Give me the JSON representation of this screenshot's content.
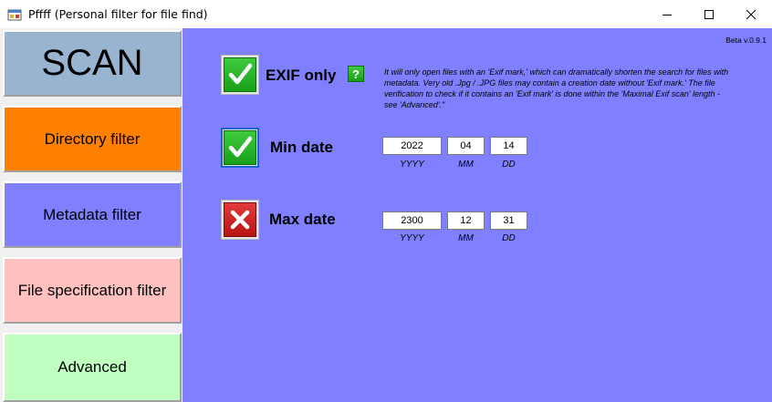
{
  "window": {
    "title": "Pffff (Personal filter for file find)"
  },
  "sidebar": {
    "scan_label": "SCAN",
    "directory_filter_label": "Directory filter",
    "metadata_filter_label": "Metadata filter",
    "file_spec_filter_label": "File specification filter",
    "advanced_label": "Advanced"
  },
  "main": {
    "version": "Beta v.0.9.1",
    "exif_only": {
      "label": "EXIF only",
      "checked": true,
      "help_label": "?",
      "description": "It will only open files with an 'Exif mark,' which can dramatically shorten the search for files with metadata. Very old .Jpg / .JPG files may contain a creation date without 'Exif mark.' The file verification to check if it contains an 'Exif mark' is done within the 'Maximal Exif scan' length - see 'Advanced'.\""
    },
    "min_date": {
      "label": "Min date",
      "checked": true,
      "year": "2022",
      "month": "04",
      "day": "14",
      "year_caption": "YYYY",
      "month_caption": "MM",
      "day_caption": "DD"
    },
    "max_date": {
      "label": "Max date",
      "checked": false,
      "year": "2300",
      "month": "12",
      "day": "31",
      "year_caption": "YYYY",
      "month_caption": "MM",
      "day_caption": "DD"
    }
  },
  "colors": {
    "scan_bg": "#99b4d1",
    "directory_bg": "#ff8000",
    "metadata_bg": "#8080ff",
    "file_spec_bg": "#ffc0c0",
    "advanced_bg": "#c0ffc0",
    "main_bg": "#8080ff"
  }
}
